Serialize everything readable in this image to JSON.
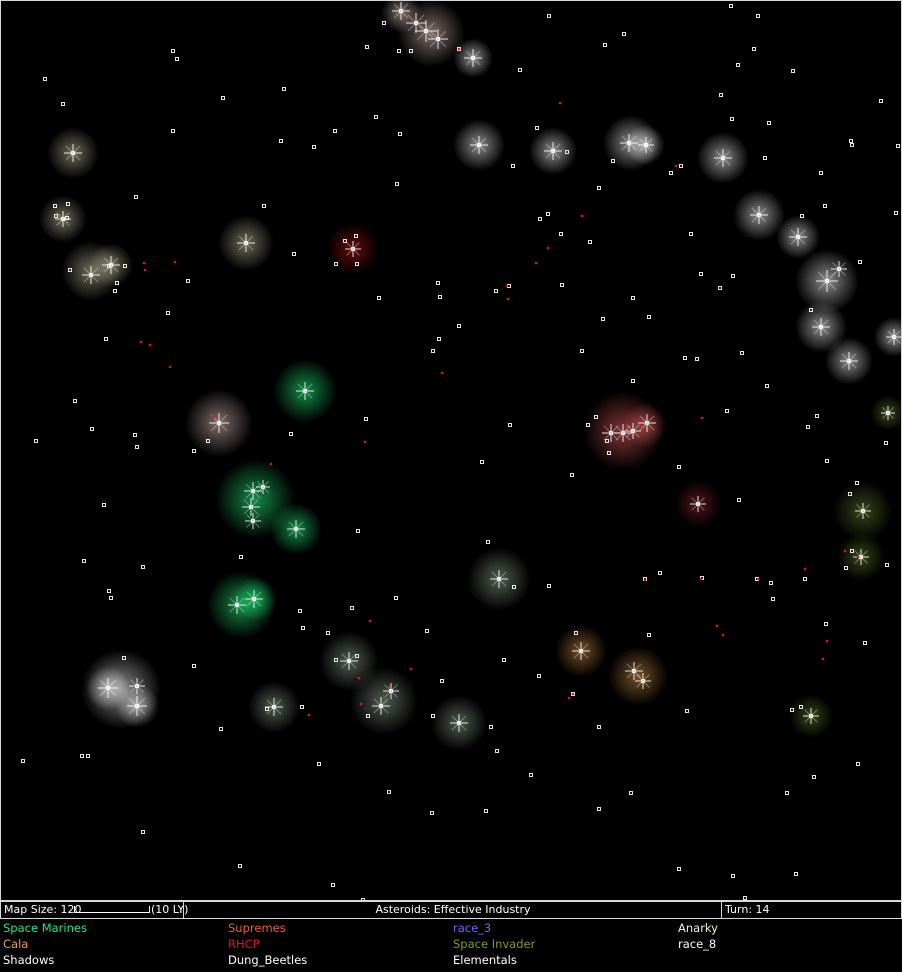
{
  "status_bar": {
    "map_size": "Map Size: 120",
    "scale_label": "(10 LY)",
    "message": "Asteroids: Effective Industry",
    "turn": "Turn: 14"
  },
  "races": [
    {
      "name": "Space Marines",
      "color": "#22e87a"
    },
    {
      "name": "Supremes",
      "color": "#e8603a"
    },
    {
      "name": "race_3",
      "color": "#6a6aff"
    },
    {
      "name": "Anarky",
      "color": "#f0f0c8"
    },
    {
      "name": "Cala",
      "color": "#e8a050"
    },
    {
      "name": "RHCP",
      "color": "#e01818"
    },
    {
      "name": "Space Invader",
      "color": "#7a9a38"
    },
    {
      "name": "race_8",
      "color": "#ffffff"
    },
    {
      "name": "Shadows",
      "color": "#ffffff"
    },
    {
      "name": "Dung_Beetles",
      "color": "#ffffff"
    },
    {
      "name": "Elementals",
      "color": "#ffffff"
    }
  ],
  "map_colors": {
    "star": "#ffffff",
    "red_marker": "#e01818",
    "border": "#d8d8d8"
  }
}
